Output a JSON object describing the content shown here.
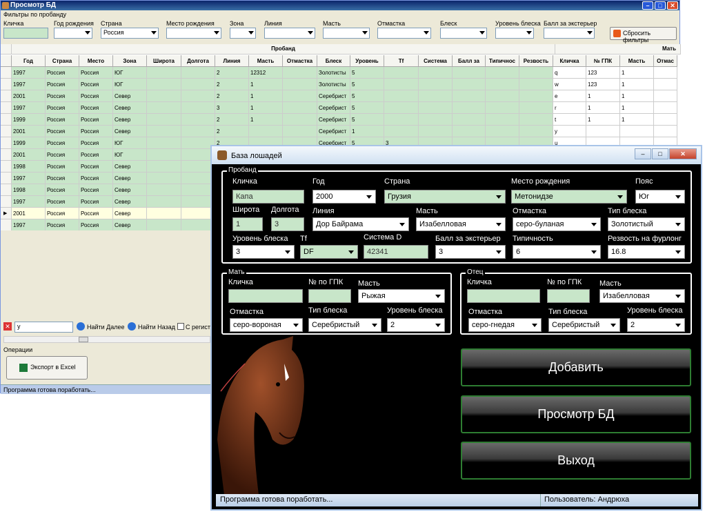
{
  "win1": {
    "title": "Просмотр БД",
    "filters_title": "Фильтры по пробанду",
    "filters": [
      {
        "label": "Кличка",
        "value": ""
      },
      {
        "label": "Год рождения",
        "value": ""
      },
      {
        "label": "Страна",
        "value": "Россия"
      },
      {
        "label": "Место рождения",
        "value": ""
      },
      {
        "label": "Зона",
        "value": ""
      },
      {
        "label": "Линия",
        "value": ""
      },
      {
        "label": "Масть",
        "value": ""
      },
      {
        "label": "Отмастка",
        "value": ""
      },
      {
        "label": "Блеск",
        "value": ""
      },
      {
        "label": "Уровень блеска",
        "value": ""
      },
      {
        "label": "Балл за экстерьер",
        "value": ""
      }
    ],
    "reset_label": "Сбросить фильтры",
    "group_proband": "Пробанд",
    "group_mother": "Мать",
    "columns": [
      "Год",
      "Страна",
      "Место",
      "Зона",
      "Широта",
      "Долгота",
      "Линия",
      "Масть",
      "Отмастка",
      "Блеск",
      "Уровень",
      "Tf",
      "Система",
      "Балл за",
      "Типичнос",
      "Резвость",
      "Кличка",
      "№ ГПК",
      "Масть",
      "Отмас"
    ],
    "rows": [
      [
        "1997",
        "Россия",
        "Россия",
        "ЮГ",
        "",
        "",
        "2",
        "12312",
        "",
        "Золотисты",
        "5",
        "",
        "",
        "",
        "",
        "",
        "q",
        "123",
        "1",
        ""
      ],
      [
        "1997",
        "Россия",
        "Россия",
        "ЮГ",
        "",
        "",
        "2",
        "1",
        "",
        "Золотисты",
        "5",
        "",
        "",
        "",
        "",
        "",
        "w",
        "123",
        "1",
        ""
      ],
      [
        "2001",
        "Россия",
        "Россия",
        "Север",
        "",
        "",
        "2",
        "1",
        "",
        "Серебрист",
        "5",
        "",
        "",
        "",
        "",
        "",
        "e",
        "1",
        "1",
        ""
      ],
      [
        "1997",
        "Россия",
        "Россия",
        "Север",
        "",
        "",
        "3",
        "1",
        "",
        "Серебрист",
        "5",
        "",
        "",
        "",
        "",
        "",
        "r",
        "1",
        "1",
        ""
      ],
      [
        "1999",
        "Россия",
        "Россия",
        "Север",
        "",
        "",
        "2",
        "1",
        "",
        "Серебрист",
        "5",
        "",
        "",
        "",
        "",
        "",
        "t",
        "1",
        "1",
        ""
      ],
      [
        "2001",
        "Россия",
        "Россия",
        "Север",
        "",
        "",
        "2",
        "",
        "",
        "Серебрист",
        "1",
        "",
        "",
        "",
        "",
        "",
        "y",
        "",
        "",
        ""
      ],
      [
        "1999",
        "Россия",
        "Россия",
        "ЮГ",
        "",
        "",
        "2",
        "",
        "",
        "Серебрист",
        "5",
        "3",
        "",
        "",
        "",
        "",
        "u",
        "",
        "",
        ""
      ],
      [
        "2001",
        "Россия",
        "Россия",
        "ЮГ",
        "",
        "",
        "",
        "",
        "",
        "",
        "",
        "",
        "",
        "",
        "",
        "",
        "",
        "",
        "",
        ""
      ],
      [
        "1998",
        "Россия",
        "Россия",
        "Север",
        "",
        "",
        "",
        "",
        "",
        "",
        "",
        "",
        "",
        "",
        "",
        "",
        "",
        "",
        "",
        ""
      ],
      [
        "1997",
        "Россия",
        "Россия",
        "Север",
        "",
        "",
        "",
        "",
        "",
        "",
        "",
        "",
        "",
        "",
        "",
        "",
        "",
        "",
        "",
        ""
      ],
      [
        "1998",
        "Россия",
        "Россия",
        "Север",
        "",
        "",
        "",
        "",
        "",
        "",
        "",
        "",
        "",
        "",
        "",
        "",
        "",
        "",
        "",
        ""
      ],
      [
        "1997",
        "Россия",
        "Россия",
        "Север",
        "",
        "",
        "",
        "",
        "",
        "",
        "",
        "",
        "",
        "",
        "",
        "",
        "",
        "",
        "",
        ""
      ],
      [
        "2001",
        "Россия",
        "Россия",
        "Север",
        "",
        "",
        "",
        "",
        "",
        "",
        "",
        "",
        "",
        "",
        "",
        "",
        "",
        "",
        "",
        ""
      ],
      [
        "1997",
        "Россия",
        "Россия",
        "Север",
        "",
        "",
        "",
        "",
        "",
        "",
        "",
        "",
        "",
        "",
        "",
        "",
        "",
        "",
        "",
        ""
      ]
    ],
    "search_value": "у",
    "find_next": "Найти Далее",
    "find_prev": "Найти Назад",
    "case_label": "С регистр",
    "ops_label": "Операции",
    "export_label": "Экспорт в Excel",
    "status": "Программа готова поработать..."
  },
  "win2": {
    "title": "База лошадей",
    "proband": {
      "group": "Пробанд",
      "name_label": "Кличка",
      "name": "Капа",
      "year_label": "Год",
      "year": "2000",
      "country_label": "Страна",
      "country": "Грузия",
      "birthplace_label": "Место рождения",
      "birthplace": "Метонидзе",
      "belt_label": "Пояс",
      "belt": "Юг",
      "lat_label": "Широта",
      "lat": "1",
      "lon_label": "Долгота",
      "lon": "3",
      "line_label": "Линия",
      "line": "Дор Байрама",
      "color_label": "Масть",
      "color": "Изабелловая",
      "shade_label": "Отмастка",
      "shade": "серо-буланая",
      "shine_type_label": "Тип блеска",
      "shine_type": "Золотистый",
      "shine_level_label": "Уровень блеска",
      "shine_level": "3",
      "tf_label": "Tf",
      "tf": "DF",
      "sysd_label": "Система D",
      "sysd": "42341",
      "ext_label": "Балл за экстерьер",
      "ext": "3",
      "typ_label": "Типичность",
      "typ": "6",
      "speed_label": "Резвость на фурлонг",
      "speed": "16.8"
    },
    "mother": {
      "group": "Мать",
      "name_label": "Кличка",
      "name": "",
      "gpk_label": "№ по ГПК",
      "gpk": "",
      "color_label": "Масть",
      "color": "Рыжая",
      "shade_label": "Отмастка",
      "shade": "серо-вороная",
      "shine_type_label": "Тип блеска",
      "shine_type": "Серебристый",
      "shine_level_label": "Уровень блеска",
      "shine_level": "2"
    },
    "father": {
      "group": "Отец",
      "name_label": "Кличка",
      "name": "",
      "gpk_label": "№ по ГПК",
      "gpk": "",
      "color_label": "Масть",
      "color": "Изабелловая",
      "shade_label": "Отмастка",
      "shade": "серо-гнедая",
      "shine_type_label": "Тип блеска",
      "shine_type": "Серебристый",
      "shine_level_label": "Уровень блеска",
      "shine_level": "2"
    },
    "add_label": "Добавить",
    "view_label": "Просмотр БД",
    "exit_label": "Выход",
    "status": "Программа готова поработать...",
    "user": "Пользователь: Андрюха"
  },
  "colors": {
    "green_cell": "#c8e6c9",
    "selected_row": "#ffffe0",
    "accent_green": "#2e7d32"
  }
}
